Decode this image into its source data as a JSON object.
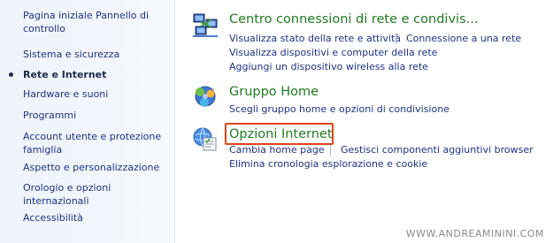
{
  "sidebar": {
    "items": [
      {
        "label": "Pagina iniziale Pannello di controllo"
      },
      {
        "label": "Sistema e sicurezza"
      },
      {
        "label": "Rete e Internet"
      },
      {
        "label": "Hardware e suoni"
      },
      {
        "label": "Programmi"
      },
      {
        "label": "Account utente e protezione famiglia"
      },
      {
        "label": "Aspetto e personalizzazione"
      },
      {
        "label": "Orologio e opzioni internazionali"
      },
      {
        "label": "Accessibilità"
      }
    ]
  },
  "categories": [
    {
      "title": "Centro connessioni di rete e condivis...",
      "icon": "network-icon",
      "tasks": [
        "Visualizza stato della rete e attività",
        "Connessione a una rete",
        "Visualizza dispositivi e computer della rete",
        "Aggiungi un dispositivo wireless alla rete"
      ]
    },
    {
      "title": "Gruppo Home",
      "icon": "homegroup-icon",
      "tasks": [
        "Scegli gruppo home e opzioni di condivisione"
      ]
    },
    {
      "title": "Opzioni Internet",
      "icon": "internet-options-icon",
      "tasks": [
        "Cambia home page",
        "Gestisci componenti aggiuntivi browser",
        "Elimina cronologia esplorazione e cookie"
      ]
    }
  ],
  "watermark": "WWW.ANDREAMININI.COM",
  "colors": {
    "link": "#1e3287",
    "category_title": "#1e7b1e",
    "highlight": "#e2431b"
  }
}
